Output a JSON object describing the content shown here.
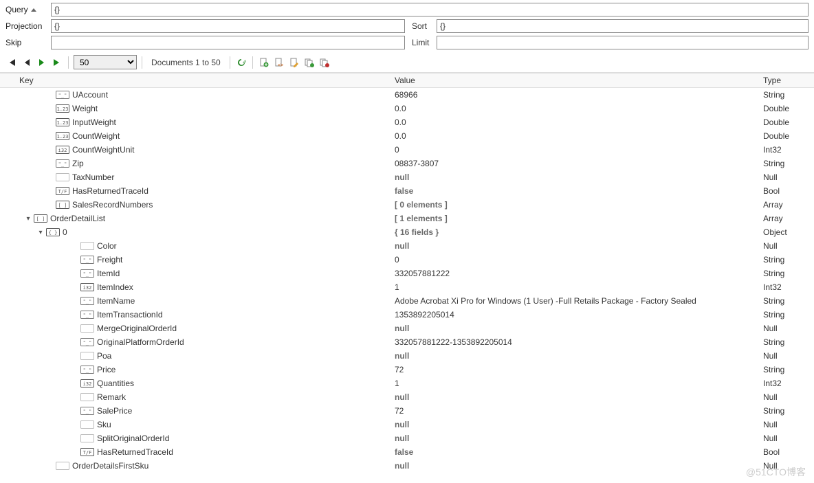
{
  "query": {
    "query_label": "Query",
    "query_value": "{}",
    "projection_label": "Projection",
    "projection_value": "{}",
    "sort_label": "Sort",
    "sort_value": "{}",
    "skip_label": "Skip",
    "skip_value": "",
    "limit_label": "Limit",
    "limit_value": ""
  },
  "toolbar": {
    "page_size": "50",
    "docs_label": "Documents 1 to 50"
  },
  "headers": {
    "key": "Key",
    "value": "Value",
    "type": "Type"
  },
  "rows": [
    {
      "indent": 1,
      "exp": "",
      "icon": "str",
      "key": "UAccount",
      "value": "68966",
      "vclass": "val-str",
      "type": "String"
    },
    {
      "indent": 1,
      "exp": "",
      "icon": "dbl",
      "key": "Weight",
      "value": "0.0",
      "vclass": "val-str",
      "type": "Double"
    },
    {
      "indent": 1,
      "exp": "",
      "icon": "dbl",
      "key": "InputWeight",
      "value": "0.0",
      "vclass": "val-str",
      "type": "Double"
    },
    {
      "indent": 1,
      "exp": "",
      "icon": "dbl",
      "key": "CountWeight",
      "value": "0.0",
      "vclass": "val-str",
      "type": "Double"
    },
    {
      "indent": 1,
      "exp": "",
      "icon": "int",
      "key": "CountWeightUnit",
      "value": "0",
      "vclass": "val-str",
      "type": "Int32"
    },
    {
      "indent": 1,
      "exp": "",
      "icon": "str",
      "key": "Zip",
      "value": "08837-3807",
      "vclass": "val-str",
      "type": "String"
    },
    {
      "indent": 1,
      "exp": "",
      "icon": "null",
      "key": "TaxNumber",
      "value": "null",
      "vclass": "val-null",
      "type": "Null"
    },
    {
      "indent": 1,
      "exp": "",
      "icon": "bool",
      "key": "HasReturnedTraceId",
      "value": "false",
      "vclass": "val-bool",
      "type": "Bool"
    },
    {
      "indent": 1,
      "exp": "",
      "icon": "arr",
      "key": "SalesRecordNumbers",
      "value": "[ 0 elements ]",
      "vclass": "val-structlabel",
      "type": "Array"
    },
    {
      "indent": 0,
      "exp": "v",
      "icon": "arr",
      "key": "OrderDetailList",
      "value": "[ 1 elements ]",
      "vclass": "val-structlabel",
      "type": "Array"
    },
    {
      "indent": 1,
      "exp": "v",
      "icon": "obj",
      "key": "0",
      "value": "{ 16 fields }",
      "vclass": "val-structlabel",
      "type": "Object"
    },
    {
      "indent": 3,
      "exp": "",
      "icon": "null",
      "key": "Color",
      "value": "null",
      "vclass": "val-null",
      "type": "Null"
    },
    {
      "indent": 3,
      "exp": "",
      "icon": "str",
      "key": "Freight",
      "value": "0",
      "vclass": "val-str",
      "type": "String"
    },
    {
      "indent": 3,
      "exp": "",
      "icon": "str",
      "key": "ItemId",
      "value": "332057881222",
      "vclass": "val-str",
      "type": "String"
    },
    {
      "indent": 3,
      "exp": "",
      "icon": "int",
      "key": "ItemIndex",
      "value": "1",
      "vclass": "val-str",
      "type": "Int32"
    },
    {
      "indent": 3,
      "exp": "",
      "icon": "str",
      "key": "ItemName",
      "value": "Adobe Acrobat Xi Pro for Windows (1 User) -Full Retails Package - Factory Sealed",
      "vclass": "val-str",
      "type": "String"
    },
    {
      "indent": 3,
      "exp": "",
      "icon": "str",
      "key": "ItemTransactionId",
      "value": "1353892205014",
      "vclass": "val-str",
      "type": "String"
    },
    {
      "indent": 3,
      "exp": "",
      "icon": "null",
      "key": "MergeOriginalOrderId",
      "value": "null",
      "vclass": "val-null",
      "type": "Null"
    },
    {
      "indent": 3,
      "exp": "",
      "icon": "str",
      "key": "OriginalPlatformOrderId",
      "value": "332057881222-1353892205014",
      "vclass": "val-str",
      "type": "String"
    },
    {
      "indent": 3,
      "exp": "",
      "icon": "null",
      "key": "Poa",
      "value": "null",
      "vclass": "val-null",
      "type": "Null"
    },
    {
      "indent": 3,
      "exp": "",
      "icon": "str",
      "key": "Price",
      "value": "72",
      "vclass": "val-str",
      "type": "String"
    },
    {
      "indent": 3,
      "exp": "",
      "icon": "int",
      "key": "Quantities",
      "value": "1",
      "vclass": "val-str",
      "type": "Int32"
    },
    {
      "indent": 3,
      "exp": "",
      "icon": "null",
      "key": "Remark",
      "value": "null",
      "vclass": "val-null",
      "type": "Null"
    },
    {
      "indent": 3,
      "exp": "",
      "icon": "str",
      "key": "SalePrice",
      "value": "72",
      "vclass": "val-str",
      "type": "String"
    },
    {
      "indent": 3,
      "exp": "",
      "icon": "null",
      "key": "Sku",
      "value": "null",
      "vclass": "val-null",
      "type": "Null"
    },
    {
      "indent": 3,
      "exp": "",
      "icon": "null",
      "key": "SplitOriginalOrderId",
      "value": "null",
      "vclass": "val-null",
      "type": "Null"
    },
    {
      "indent": 3,
      "exp": "",
      "icon": "bool",
      "key": "HasReturnedTraceId",
      "value": "false",
      "vclass": "val-bool",
      "type": "Bool"
    },
    {
      "indent": 1,
      "exp": "",
      "icon": "null",
      "key": "OrderDetailsFirstSku",
      "value": "null",
      "vclass": "val-null",
      "type": "Null"
    }
  ],
  "watermark": "@51CTO博客"
}
